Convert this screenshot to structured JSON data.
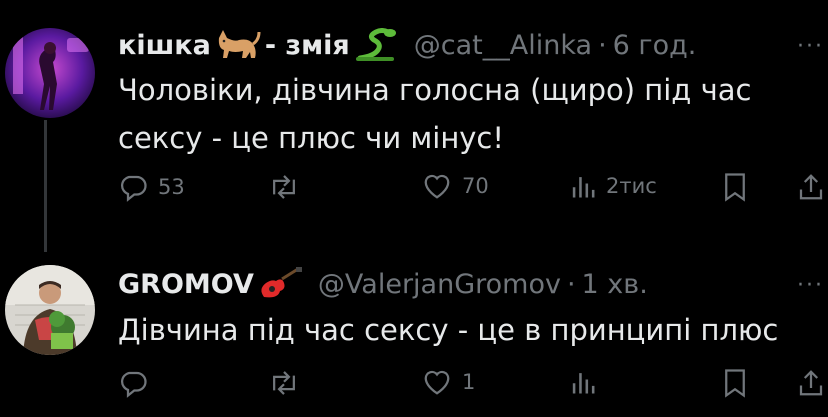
{
  "colors": {
    "background": "#000000",
    "text": "#e7e9ea",
    "muted": "#71767b",
    "thread_line": "#333639"
  },
  "tweet1": {
    "name_part1": "кішка",
    "name_part2": "- змія",
    "emoji1": "cat-emoji",
    "emoji2": "snake-emoji",
    "handle": "@cat__Alinka",
    "time": "6 год.",
    "text_line1": "Чоловіки, дівчина голосна (щиро) під час",
    "text_line2": "сексу - це плюс чи мінус!",
    "replies": "53",
    "likes": "70",
    "views": "2тис"
  },
  "tweet2": {
    "name": "GROMOV",
    "emoji": "guitar-emoji",
    "handle": "@ValerjanGromov",
    "time": "1 хв.",
    "text": "Дівчина під час сексу - це в принципі плюс",
    "likes": "1"
  },
  "separator": "·",
  "more_label": "···"
}
